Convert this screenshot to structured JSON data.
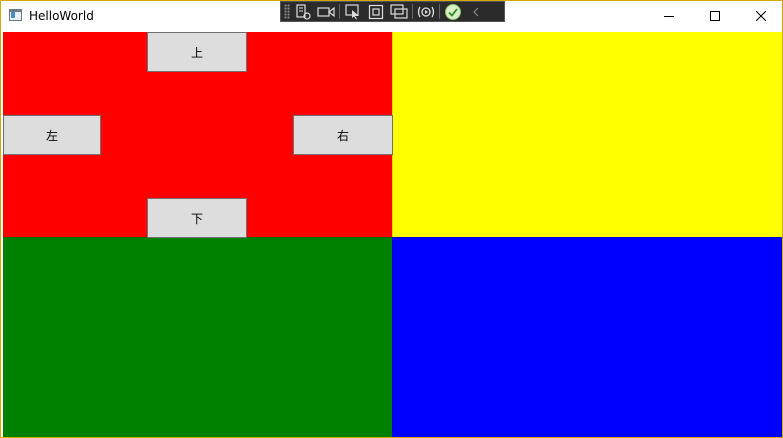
{
  "window": {
    "title": "HelloWorld",
    "icon": "app-window-icon"
  },
  "title_buttons": {
    "minimize": "minimize-icon",
    "maximize": "maximize-icon",
    "close": "close-icon"
  },
  "debug_toolbar": {
    "icons": [
      "grip-icon",
      "live-visual-tree-icon",
      "record-video-icon",
      "select-element-icon",
      "display-layout-adorners-icon",
      "track-focused-element-icon",
      "hot-reload-icon",
      "binding-check-icon",
      "collapse-chevron-icon"
    ]
  },
  "grid": {
    "quadrants": [
      {
        "name": "top-left",
        "color": "#ff0000"
      },
      {
        "name": "top-right",
        "color": "#ffff00"
      },
      {
        "name": "bottom-left",
        "color": "#008000"
      },
      {
        "name": "bottom-right",
        "color": "#0000ff"
      }
    ]
  },
  "buttons": {
    "up": "上",
    "left": "左",
    "right": "右",
    "down": "下"
  }
}
